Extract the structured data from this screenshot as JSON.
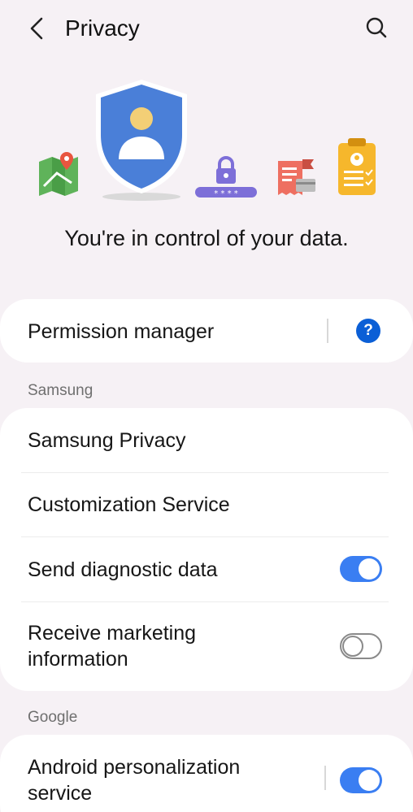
{
  "header": {
    "title": "Privacy",
    "back_icon": "chevron-left-icon",
    "search_icon": "search-icon"
  },
  "hero": {
    "tagline": "You're in control of your data.",
    "icons": [
      "map-pin-icon",
      "shield-user-icon",
      "password-lock-icon",
      "receipt-card-icon",
      "clipboard-profile-icon"
    ],
    "colors": {
      "shield": "#4a7fd8",
      "user_head": "#f3cf76",
      "lock": "#7d6fd8",
      "receipt": "#ee6f61",
      "clipboard": "#f6b72c",
      "map": "#5fb35a"
    }
  },
  "permission_card": {
    "label": "Permission manager",
    "help_icon": "question-circle-icon",
    "help_glyph": "?"
  },
  "samsung_section": {
    "header": "Samsung",
    "items": [
      {
        "label": "Samsung Privacy"
      },
      {
        "label": "Customization Service"
      },
      {
        "label": "Send diagnostic data",
        "toggle": "on"
      },
      {
        "label_line1": "Receive marketing",
        "label_line2": "information",
        "toggle": "off"
      }
    ]
  },
  "google_section": {
    "header": "Google",
    "items": [
      {
        "label_line1": "Android personalization",
        "label_line2": "service",
        "toggle": "on"
      }
    ]
  },
  "colors": {
    "accent": "#3a7ef2",
    "background": "#f6f1f5",
    "card": "#ffffff",
    "help": "#0b5fd6"
  }
}
